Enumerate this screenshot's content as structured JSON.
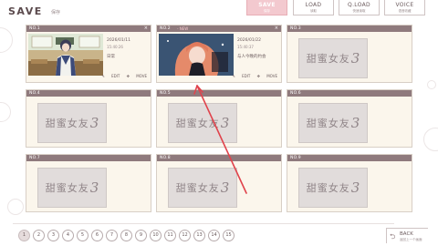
{
  "header": {
    "title": "SAVE",
    "subtitle": "保存"
  },
  "tabs": [
    {
      "id": "save",
      "label": "SAVE",
      "sub": "保存"
    },
    {
      "id": "load",
      "label": "LOAD",
      "sub": "读取"
    },
    {
      "id": "qload",
      "label": "Q.LOAD",
      "sub": "快速读取"
    },
    {
      "id": "voice",
      "label": "VOICE",
      "sub": "语音收藏"
    }
  ],
  "slots": [
    {
      "num": "NO.1",
      "date": "2026/01/11",
      "time": "15:40:26",
      "title": "日常",
      "edit": "EDIT",
      "move": "MOVE",
      "close": "×"
    },
    {
      "num": "NO.2",
      "new_badge": "- NEW",
      "date": "2026/01/22",
      "time": "15:40:37",
      "title": "与人今晚的约会",
      "edit": "EDIT",
      "move": "MOVE",
      "close": "×"
    },
    {
      "num": "NO.3"
    },
    {
      "num": "NO.4"
    },
    {
      "num": "NO.5"
    },
    {
      "num": "NO.6"
    },
    {
      "num": "NO.7"
    },
    {
      "num": "NO.8"
    },
    {
      "num": "NO.9"
    }
  ],
  "empty_logo": {
    "text": "甜蜜女友",
    "num": "3"
  },
  "pagination": {
    "current": "1",
    "pages": [
      "1",
      "2",
      "3",
      "4",
      "5",
      "6",
      "7",
      "8",
      "9",
      "10",
      "11",
      "12",
      "13",
      "14",
      "15"
    ]
  },
  "back": {
    "label": "BACK",
    "sub": "返回上一个画面",
    "icon": "back-arrow-icon"
  },
  "colors": {
    "accent": "#f3c9cf",
    "slot_header": "#8f7a7d",
    "slot_bg": "#fbf6ec",
    "arrow": "#e0434c"
  }
}
